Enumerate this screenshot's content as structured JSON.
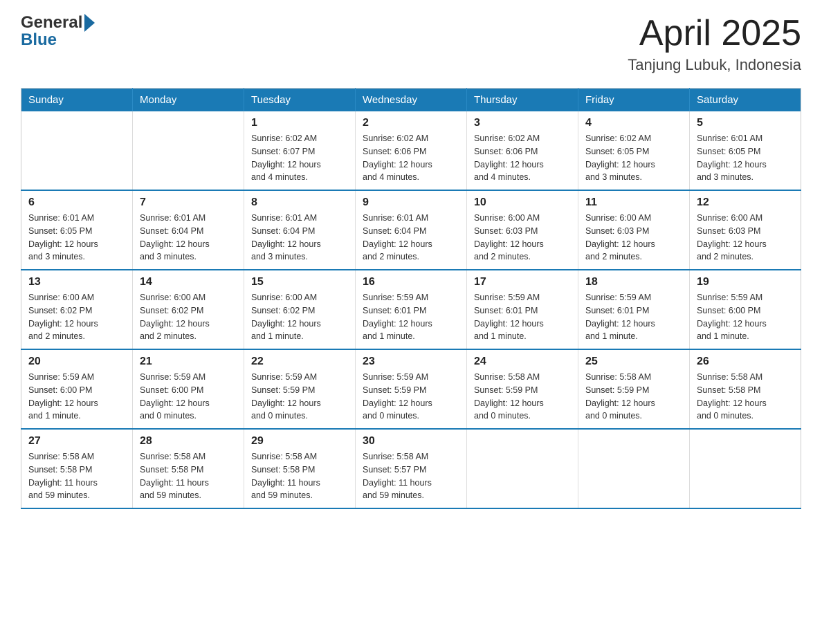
{
  "header": {
    "logo": {
      "general": "General",
      "blue": "Blue",
      "triangle": "▶"
    },
    "title": "April 2025",
    "location": "Tanjung Lubuk, Indonesia"
  },
  "weekdays": [
    "Sunday",
    "Monday",
    "Tuesday",
    "Wednesday",
    "Thursday",
    "Friday",
    "Saturday"
  ],
  "weeks": [
    {
      "days": [
        {
          "number": "",
          "info": ""
        },
        {
          "number": "",
          "info": ""
        },
        {
          "number": "1",
          "info": "Sunrise: 6:02 AM\nSunset: 6:07 PM\nDaylight: 12 hours\nand 4 minutes."
        },
        {
          "number": "2",
          "info": "Sunrise: 6:02 AM\nSunset: 6:06 PM\nDaylight: 12 hours\nand 4 minutes."
        },
        {
          "number": "3",
          "info": "Sunrise: 6:02 AM\nSunset: 6:06 PM\nDaylight: 12 hours\nand 4 minutes."
        },
        {
          "number": "4",
          "info": "Sunrise: 6:02 AM\nSunset: 6:05 PM\nDaylight: 12 hours\nand 3 minutes."
        },
        {
          "number": "5",
          "info": "Sunrise: 6:01 AM\nSunset: 6:05 PM\nDaylight: 12 hours\nand 3 minutes."
        }
      ]
    },
    {
      "days": [
        {
          "number": "6",
          "info": "Sunrise: 6:01 AM\nSunset: 6:05 PM\nDaylight: 12 hours\nand 3 minutes."
        },
        {
          "number": "7",
          "info": "Sunrise: 6:01 AM\nSunset: 6:04 PM\nDaylight: 12 hours\nand 3 minutes."
        },
        {
          "number": "8",
          "info": "Sunrise: 6:01 AM\nSunset: 6:04 PM\nDaylight: 12 hours\nand 3 minutes."
        },
        {
          "number": "9",
          "info": "Sunrise: 6:01 AM\nSunset: 6:04 PM\nDaylight: 12 hours\nand 2 minutes."
        },
        {
          "number": "10",
          "info": "Sunrise: 6:00 AM\nSunset: 6:03 PM\nDaylight: 12 hours\nand 2 minutes."
        },
        {
          "number": "11",
          "info": "Sunrise: 6:00 AM\nSunset: 6:03 PM\nDaylight: 12 hours\nand 2 minutes."
        },
        {
          "number": "12",
          "info": "Sunrise: 6:00 AM\nSunset: 6:03 PM\nDaylight: 12 hours\nand 2 minutes."
        }
      ]
    },
    {
      "days": [
        {
          "number": "13",
          "info": "Sunrise: 6:00 AM\nSunset: 6:02 PM\nDaylight: 12 hours\nand 2 minutes."
        },
        {
          "number": "14",
          "info": "Sunrise: 6:00 AM\nSunset: 6:02 PM\nDaylight: 12 hours\nand 2 minutes."
        },
        {
          "number": "15",
          "info": "Sunrise: 6:00 AM\nSunset: 6:02 PM\nDaylight: 12 hours\nand 1 minute."
        },
        {
          "number": "16",
          "info": "Sunrise: 5:59 AM\nSunset: 6:01 PM\nDaylight: 12 hours\nand 1 minute."
        },
        {
          "number": "17",
          "info": "Sunrise: 5:59 AM\nSunset: 6:01 PM\nDaylight: 12 hours\nand 1 minute."
        },
        {
          "number": "18",
          "info": "Sunrise: 5:59 AM\nSunset: 6:01 PM\nDaylight: 12 hours\nand 1 minute."
        },
        {
          "number": "19",
          "info": "Sunrise: 5:59 AM\nSunset: 6:00 PM\nDaylight: 12 hours\nand 1 minute."
        }
      ]
    },
    {
      "days": [
        {
          "number": "20",
          "info": "Sunrise: 5:59 AM\nSunset: 6:00 PM\nDaylight: 12 hours\nand 1 minute."
        },
        {
          "number": "21",
          "info": "Sunrise: 5:59 AM\nSunset: 6:00 PM\nDaylight: 12 hours\nand 0 minutes."
        },
        {
          "number": "22",
          "info": "Sunrise: 5:59 AM\nSunset: 5:59 PM\nDaylight: 12 hours\nand 0 minutes."
        },
        {
          "number": "23",
          "info": "Sunrise: 5:59 AM\nSunset: 5:59 PM\nDaylight: 12 hours\nand 0 minutes."
        },
        {
          "number": "24",
          "info": "Sunrise: 5:58 AM\nSunset: 5:59 PM\nDaylight: 12 hours\nand 0 minutes."
        },
        {
          "number": "25",
          "info": "Sunrise: 5:58 AM\nSunset: 5:59 PM\nDaylight: 12 hours\nand 0 minutes."
        },
        {
          "number": "26",
          "info": "Sunrise: 5:58 AM\nSunset: 5:58 PM\nDaylight: 12 hours\nand 0 minutes."
        }
      ]
    },
    {
      "days": [
        {
          "number": "27",
          "info": "Sunrise: 5:58 AM\nSunset: 5:58 PM\nDaylight: 11 hours\nand 59 minutes."
        },
        {
          "number": "28",
          "info": "Sunrise: 5:58 AM\nSunset: 5:58 PM\nDaylight: 11 hours\nand 59 minutes."
        },
        {
          "number": "29",
          "info": "Sunrise: 5:58 AM\nSunset: 5:58 PM\nDaylight: 11 hours\nand 59 minutes."
        },
        {
          "number": "30",
          "info": "Sunrise: 5:58 AM\nSunset: 5:57 PM\nDaylight: 11 hours\nand 59 minutes."
        },
        {
          "number": "",
          "info": ""
        },
        {
          "number": "",
          "info": ""
        },
        {
          "number": "",
          "info": ""
        }
      ]
    }
  ]
}
